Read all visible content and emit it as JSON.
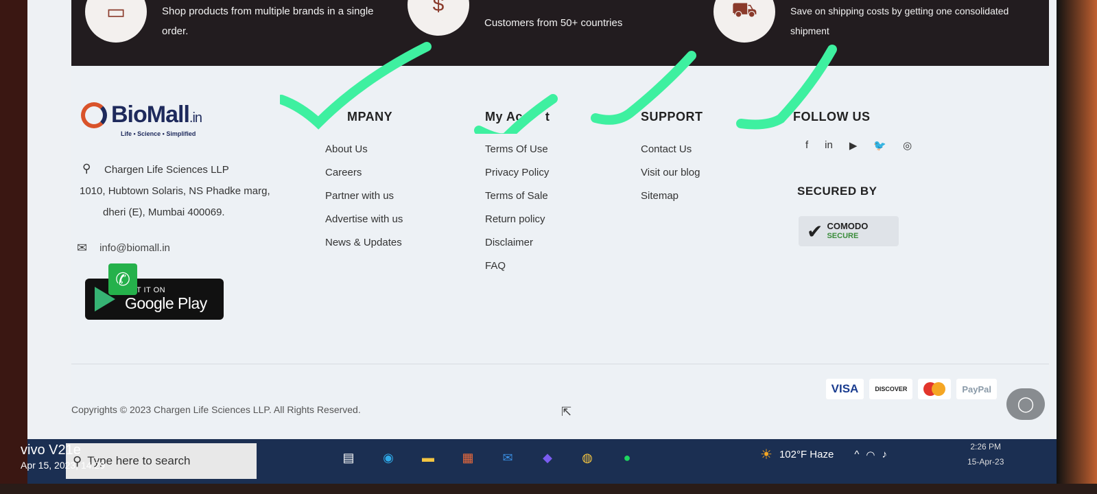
{
  "features": [
    {
      "icon": "monitor-icon",
      "text": "Shop products from multiple brands in a single order."
    },
    {
      "icon": "money-hand-icon",
      "text": "Customers from 50+ countries"
    },
    {
      "icon": "truck-icon",
      "text": "Save on shipping costs by getting one consolidated shipment"
    }
  ],
  "brand": {
    "name": "BioMall",
    "suffix": ".in",
    "tagline": "Life • Science • Simplified",
    "address_line1": "Chargen Life Sciences LLP",
    "address_line2": "1010, Hubtown Solaris, NS Phadke marg,",
    "address_line3": "dheri (E), Mumbai 400069.",
    "email": "info@biomall.in"
  },
  "google_play": {
    "small": "GET IT ON",
    "big": "Google Play"
  },
  "company": {
    "heading": "MPANY",
    "links": [
      "About Us",
      "Careers",
      "Partner with us",
      "Advertise with us",
      "News & Updates"
    ]
  },
  "account": {
    "heading": "My Ac      t",
    "links": [
      "Terms Of Use",
      "Privacy Policy",
      "Terms of Sale",
      "Return policy",
      "Disclaimer",
      "FAQ"
    ]
  },
  "support": {
    "heading": "SUPPORT",
    "links": [
      "Contact Us",
      "Visit our blog",
      "Sitemap"
    ]
  },
  "follow": {
    "heading": "FOLLOW US",
    "icons": [
      "facebook-icon",
      "linkedin-icon",
      "youtube-icon",
      "twitter-icon",
      "instagram-icon"
    ]
  },
  "secured": {
    "heading": "SECURED BY",
    "badge_top": "COMODO",
    "badge_bottom": "SECURE"
  },
  "copyright": "Copyrights © 2023 Chargen Life Sciences LLP. All Rights Reserved.",
  "payments": [
    "VISA",
    "DISCOVER",
    "",
    "PayPal"
  ],
  "taskbar": {
    "search_placeholder": "Type here to search",
    "weather": "102°F  Haze",
    "time": "2:26 PM",
    "date": "15-Apr-23"
  },
  "watermark": {
    "device": "vivo V21e",
    "datetime": "Apr 15, 2023, 14:29"
  },
  "colors": {
    "accent_check": "#3ef0a0",
    "footer_bg": "#edf1f5",
    "feature_bar": "#221c1f"
  }
}
